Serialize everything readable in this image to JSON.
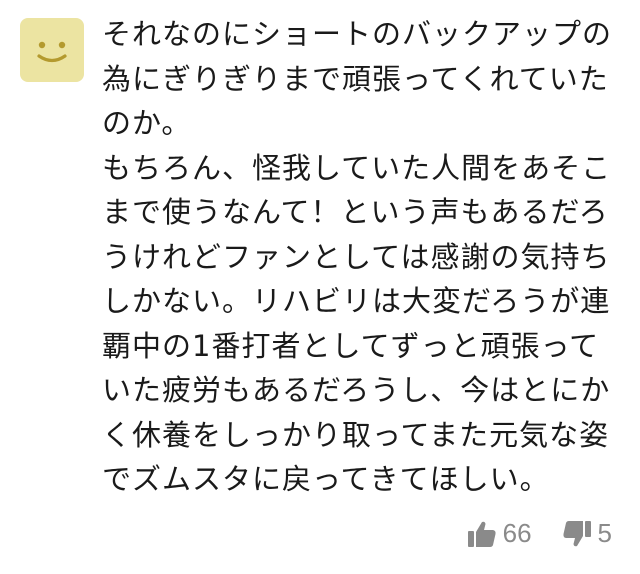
{
  "comment": {
    "avatar_icon": "smiley-face-icon",
    "avatar_color": "#ece4a2",
    "lines": [
      "それなのにショートのバックアップの",
      "為にぎりぎりまで頑張ってくれていた",
      "のか。",
      "もちろん、怪我していた人間をあそこ",
      "まで使うなんて！という声もあるだろ",
      "うけれどファンとしては感謝の気持ち",
      "しかない。リハビリは大変だろうが連",
      "覇中の1番打者としてずっと頑張って",
      "いた疲労もあるだろうし、今はとにか",
      "く休養をしっかり取ってまた元気な姿",
      "でズムスタに戻ってきてほしい。"
    ],
    "likes": {
      "icon": "thumbs-up-icon",
      "count": "66"
    },
    "dislikes": {
      "icon": "thumbs-down-icon",
      "count": "5"
    },
    "reaction_color": "#8a8a8a"
  }
}
